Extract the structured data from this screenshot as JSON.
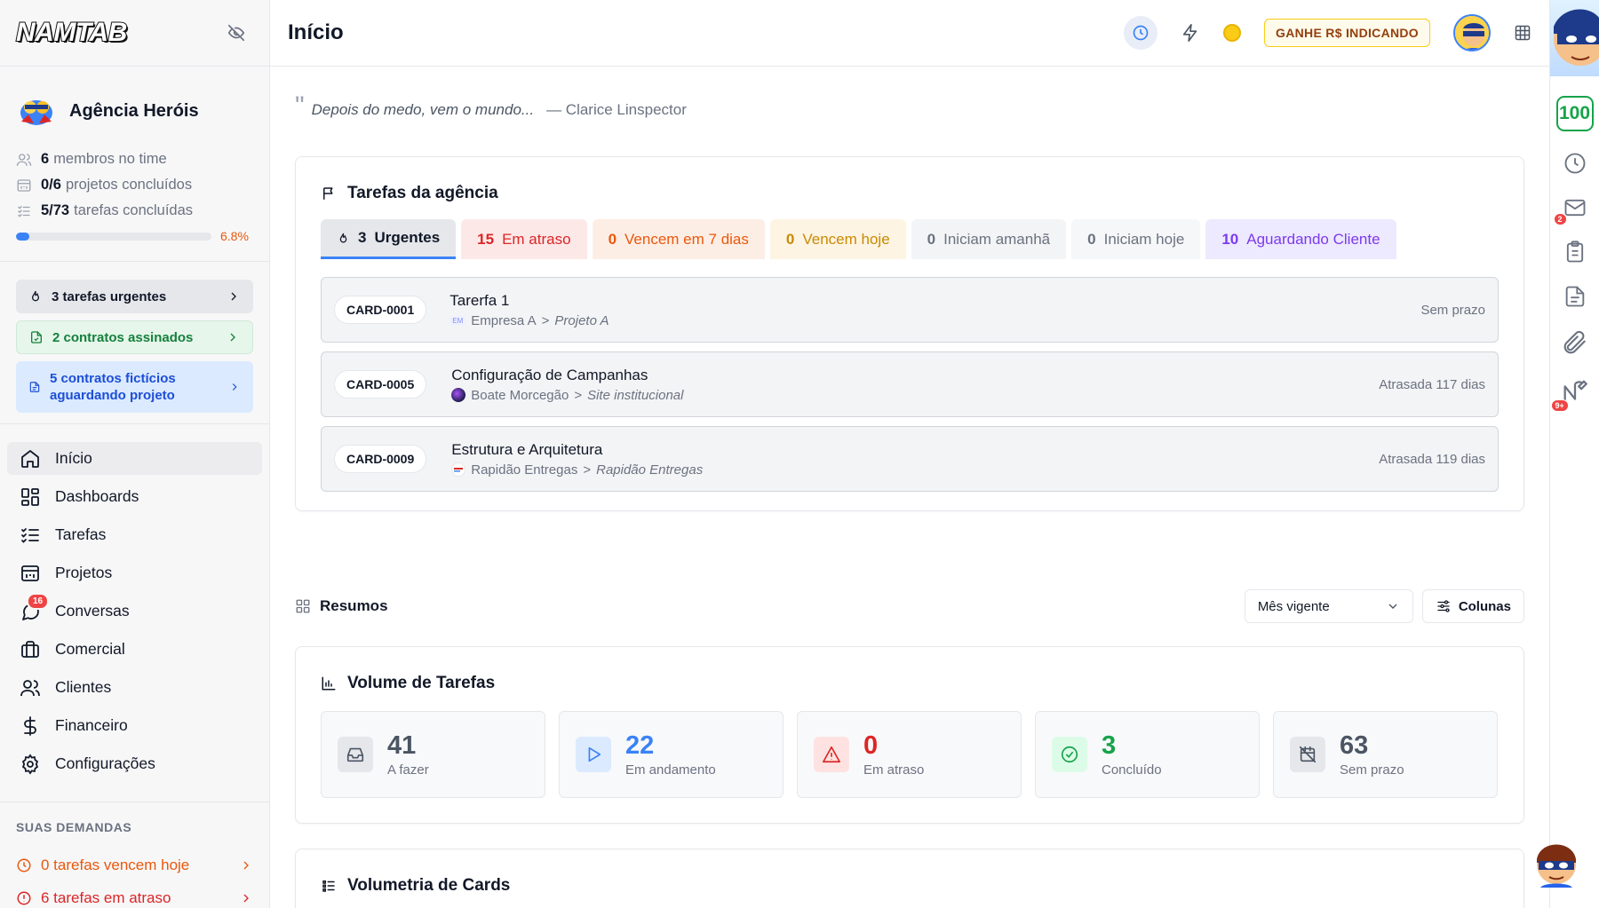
{
  "brand": {
    "logo": "NAMTAB"
  },
  "agency": {
    "name": "Agência Heróis",
    "stats": [
      {
        "num": "6",
        "text": "membros no time",
        "icon": "users-icon"
      },
      {
        "num": "0/6",
        "text": "projetos concluídos",
        "icon": "project-icon"
      },
      {
        "num": "5/73",
        "text": "tarefas concluídas",
        "icon": "tasks-icon"
      }
    ],
    "progress_pct": "6.8%",
    "progress_fraction": 0.068
  },
  "alerts": {
    "urgent": "3 tarefas urgentes",
    "contracts": "2 contratos assinados",
    "fictitious_line1": "5 contratos fictícios",
    "fictitious_line2": "aguardando projeto"
  },
  "nav": [
    {
      "label": "Início",
      "icon": "home-icon"
    },
    {
      "label": "Dashboards",
      "icon": "dashboard-icon"
    },
    {
      "label": "Tarefas",
      "icon": "tasks-icon"
    },
    {
      "label": "Projetos",
      "icon": "project-icon"
    },
    {
      "label": "Conversas",
      "icon": "chat-icon",
      "badge": "16"
    },
    {
      "label": "Comercial",
      "icon": "briefcase-icon"
    },
    {
      "label": "Clientes",
      "icon": "users-icon"
    },
    {
      "label": "Financeiro",
      "icon": "dollar-icon"
    },
    {
      "label": "Configurações",
      "icon": "gear-icon"
    }
  ],
  "demands": {
    "title": "SUAS DEMANDAS",
    "today": "0 tarefas vencem hoje",
    "late": "6 tarefas em atraso"
  },
  "header": {
    "title": "Início",
    "refer_label": "GANHE R$ INDICANDO"
  },
  "quote": {
    "mark": "\"",
    "text": "Depois do medo, vem o mundo...",
    "author": "— Clarice Linspector"
  },
  "tasks_card": {
    "title": "Tarefas da agência",
    "tabs": [
      {
        "num": "3",
        "label": "Urgentes"
      },
      {
        "num": "15",
        "label": "Em atraso"
      },
      {
        "num": "0",
        "label": "Vencem em 7 dias"
      },
      {
        "num": "0",
        "label": "Vencem hoje"
      },
      {
        "num": "0",
        "label": "Iniciam amanhã"
      },
      {
        "num": "0",
        "label": "Iniciam hoje"
      },
      {
        "num": "10",
        "label": "Aguardando Cliente"
      }
    ],
    "rows": [
      {
        "code": "CARD-0001",
        "name": "Tarerfa 1",
        "client_badge": "EM",
        "client": "Empresa A",
        "sep": ">",
        "project": "Projeto A",
        "due": "Sem prazo"
      },
      {
        "code": "CARD-0005",
        "name": "Configuração de Campanhas",
        "client": "Boate Morcegão",
        "sep": ">",
        "project": "Site institucional",
        "due": "Atrasada 117 dias"
      },
      {
        "code": "CARD-0009",
        "name": "Estrutura e Arquitetura",
        "client": "Rapidão Entregas",
        "sep": ">",
        "project": "Rapidão Entregas",
        "due": "Atrasada 119 dias"
      }
    ]
  },
  "summaries": {
    "title": "Resumos",
    "period": "Mês vigente",
    "columns_label": "Colunas"
  },
  "volume": {
    "title": "Volume de Tarefas",
    "metrics": [
      {
        "value": "41",
        "label": "A fazer",
        "color": "#4b5563"
      },
      {
        "value": "22",
        "label": "Em andamento",
        "color": "#3b82f6"
      },
      {
        "value": "0",
        "label": "Em atraso",
        "color": "#dc2626"
      },
      {
        "value": "3",
        "label": "Concluído",
        "color": "#16a34a"
      },
      {
        "value": "63",
        "label": "Sem prazo",
        "color": "#4b5563"
      }
    ]
  },
  "volumetry": {
    "title": "Volumetria de Cards"
  },
  "rail": {
    "score": "100",
    "mail_badge": "2",
    "notif_badge": "9+"
  },
  "colors": {
    "accent": "#3b82f6",
    "danger": "#dc2626",
    "warning": "#ea580c",
    "success": "#16a34a",
    "purple": "#7c3aed"
  }
}
